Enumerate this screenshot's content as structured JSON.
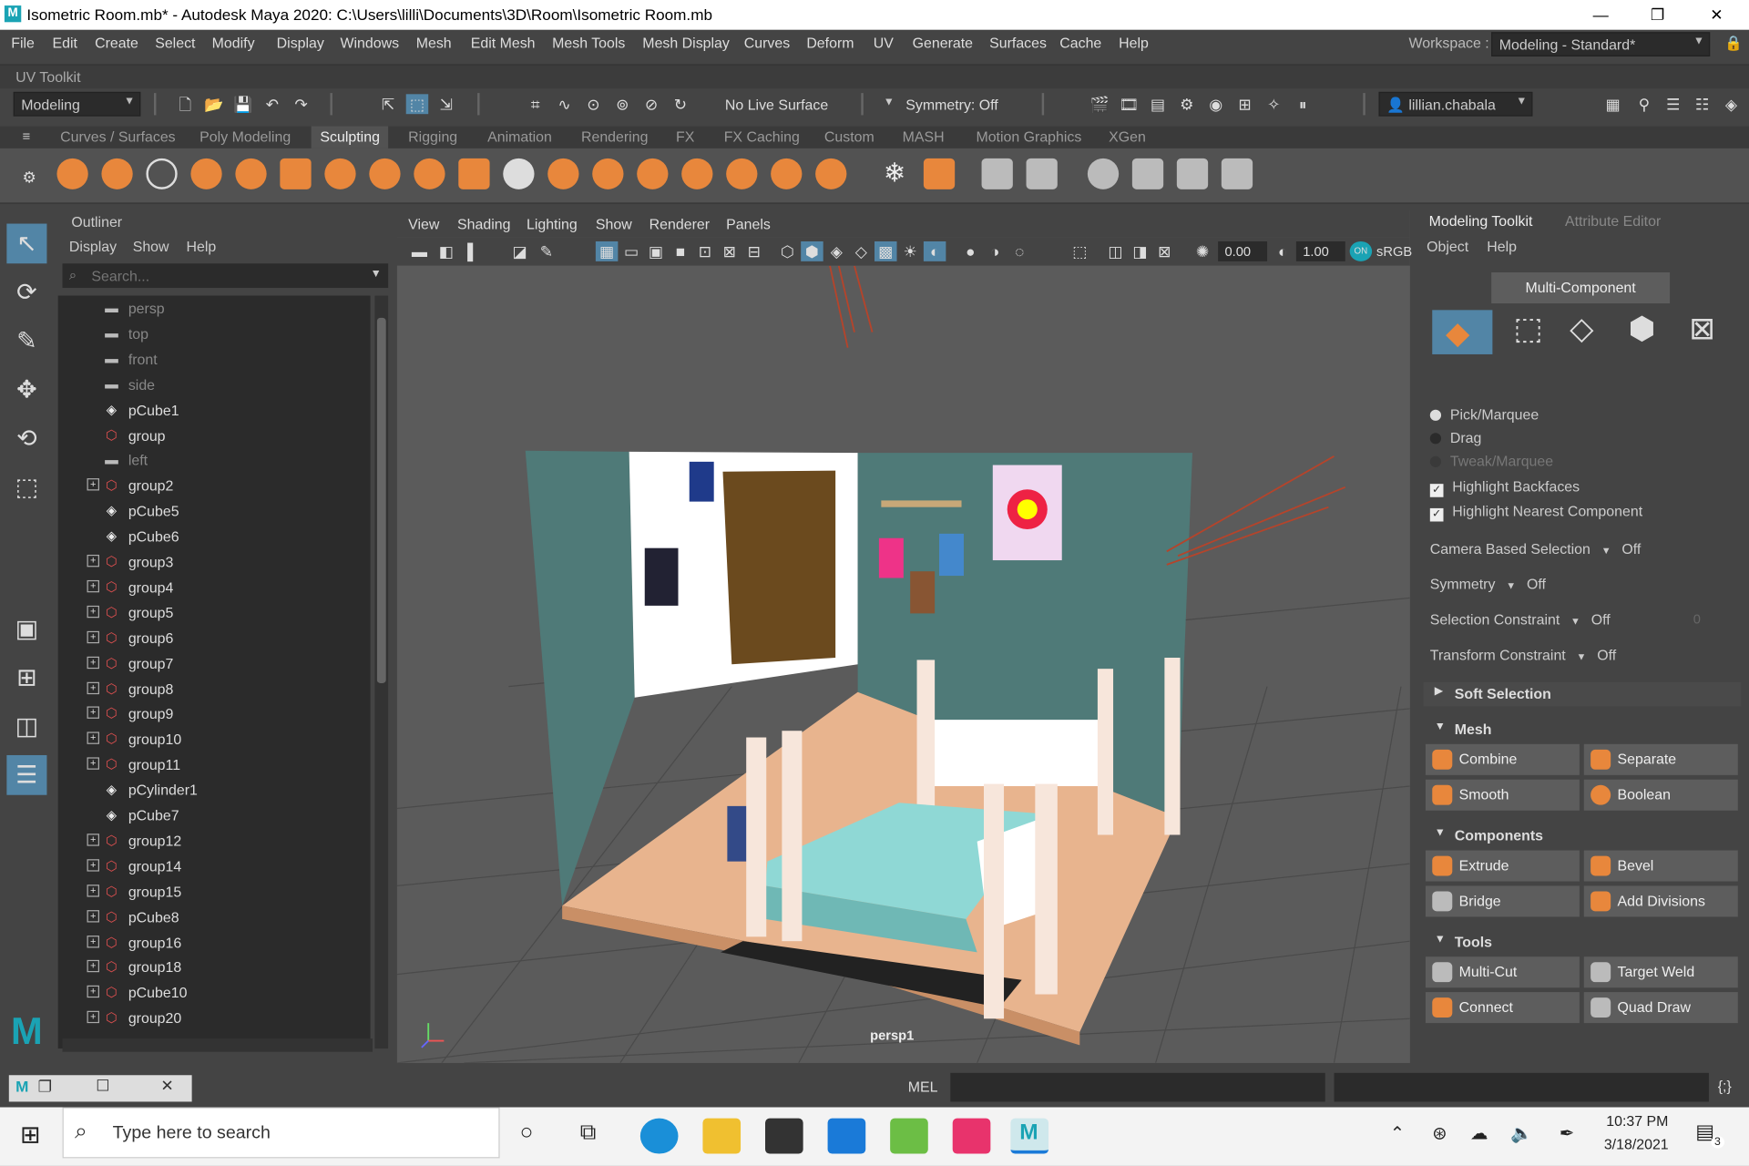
{
  "window": {
    "title": "Isometric Room.mb* - Autodesk Maya 2020: C:\\Users\\lilli\\Documents\\3D\\Room\\Isometric Room.mb",
    "minimize": "—",
    "maximize": "❐",
    "close": "✕"
  },
  "menu": [
    "File",
    "Edit",
    "Create",
    "Select",
    "Modify",
    "Display",
    "Windows",
    "Mesh",
    "Edit Mesh",
    "Mesh Tools",
    "Mesh Display",
    "Curves",
    "Deform",
    "UV",
    "Generate",
    "Surfaces",
    "Cache",
    "Help"
  ],
  "workspace": {
    "label": "Workspace :",
    "value": "Modeling - Standard*"
  },
  "uv_toolkit": "UV Toolkit",
  "status": {
    "mode": "Modeling",
    "live_surface": "No Live Surface",
    "symmetry": "Symmetry: Off",
    "user": "lillian.chabala"
  },
  "shelf_tabs": [
    "Curves / Surfaces",
    "Poly Modeling",
    "Sculpting",
    "Rigging",
    "Animation",
    "Rendering",
    "FX",
    "FX Caching",
    "Custom",
    "MASH",
    "Motion Graphics",
    "XGen"
  ],
  "shelf_active": "Sculpting",
  "outliner": {
    "title": "Outliner",
    "menu": [
      "Display",
      "Show",
      "Help"
    ],
    "search_placeholder": "Search...",
    "items": [
      {
        "name": "persp",
        "type": "camera",
        "expand": false,
        "dim": true
      },
      {
        "name": "top",
        "type": "camera",
        "expand": false,
        "dim": true
      },
      {
        "name": "front",
        "type": "camera",
        "expand": false,
        "dim": true
      },
      {
        "name": "side",
        "type": "camera",
        "expand": false,
        "dim": true
      },
      {
        "name": "pCube1",
        "type": "mesh",
        "expand": false,
        "dim": false
      },
      {
        "name": "group",
        "type": "group",
        "expand": false,
        "dim": false
      },
      {
        "name": "left",
        "type": "camera",
        "expand": false,
        "dim": true
      },
      {
        "name": "group2",
        "type": "group",
        "expand": true,
        "dim": false
      },
      {
        "name": "pCube5",
        "type": "mesh",
        "expand": false,
        "dim": false
      },
      {
        "name": "pCube6",
        "type": "mesh",
        "expand": false,
        "dim": false
      },
      {
        "name": "group3",
        "type": "group",
        "expand": true,
        "dim": false
      },
      {
        "name": "group4",
        "type": "group",
        "expand": true,
        "dim": false
      },
      {
        "name": "group5",
        "type": "group",
        "expand": true,
        "dim": false
      },
      {
        "name": "group6",
        "type": "group",
        "expand": true,
        "dim": false
      },
      {
        "name": "group7",
        "type": "group",
        "expand": true,
        "dim": false
      },
      {
        "name": "group8",
        "type": "group",
        "expand": true,
        "dim": false
      },
      {
        "name": "group9",
        "type": "group",
        "expand": true,
        "dim": false
      },
      {
        "name": "group10",
        "type": "group",
        "expand": true,
        "dim": false
      },
      {
        "name": "group11",
        "type": "group",
        "expand": true,
        "dim": false
      },
      {
        "name": "pCylinder1",
        "type": "mesh",
        "expand": false,
        "dim": false
      },
      {
        "name": "pCube7",
        "type": "mesh",
        "expand": false,
        "dim": false
      },
      {
        "name": "group12",
        "type": "group",
        "expand": true,
        "dim": false
      },
      {
        "name": "group14",
        "type": "group",
        "expand": true,
        "dim": false
      },
      {
        "name": "group15",
        "type": "group",
        "expand": true,
        "dim": false
      },
      {
        "name": "pCube8",
        "type": "group",
        "expand": true,
        "dim": false
      },
      {
        "name": "group16",
        "type": "group",
        "expand": true,
        "dim": false
      },
      {
        "name": "group18",
        "type": "group",
        "expand": true,
        "dim": false
      },
      {
        "name": "pCube10",
        "type": "group",
        "expand": true,
        "dim": false
      },
      {
        "name": "group20",
        "type": "group",
        "expand": true,
        "dim": false
      }
    ]
  },
  "viewport": {
    "menu": [
      "View",
      "Shading",
      "Lighting",
      "Show",
      "Renderer",
      "Panels"
    ],
    "exposure": "0.00",
    "gamma": "1.00",
    "colorspace": "sRGB",
    "camera_label": "persp1"
  },
  "toolkit": {
    "tabs": [
      "Modeling Toolkit",
      "Attribute Editor"
    ],
    "menu": [
      "Object",
      "Help"
    ],
    "multi_component": "Multi-Component",
    "pick": [
      "Pick/Marquee",
      "Drag",
      "Tweak/Marquee"
    ],
    "checks": [
      "Highlight Backfaces",
      "Highlight Nearest Component"
    ],
    "settings": [
      {
        "label": "Camera Based Selection",
        "value": "Off"
      },
      {
        "label": "Symmetry",
        "value": "Off"
      },
      {
        "label": "Selection Constraint",
        "value": "Off",
        "extra": "0"
      },
      {
        "label": "Transform Constraint",
        "value": "Off"
      }
    ],
    "soft_selection": "Soft Selection",
    "mesh": {
      "title": "Mesh",
      "buttons": [
        "Combine",
        "Separate",
        "Smooth",
        "Boolean"
      ]
    },
    "components": {
      "title": "Components",
      "buttons": [
        "Extrude",
        "Bevel",
        "Bridge",
        "Add Divisions"
      ]
    },
    "tools": {
      "title": "Tools",
      "buttons": [
        "Multi-Cut",
        "Target Weld",
        "Connect",
        "Quad Draw"
      ]
    }
  },
  "command": {
    "label": "MEL"
  },
  "taskbar": {
    "search_placeholder": "Type here to search",
    "time": "10:37 PM",
    "date": "3/18/2021",
    "notifications": "3"
  }
}
